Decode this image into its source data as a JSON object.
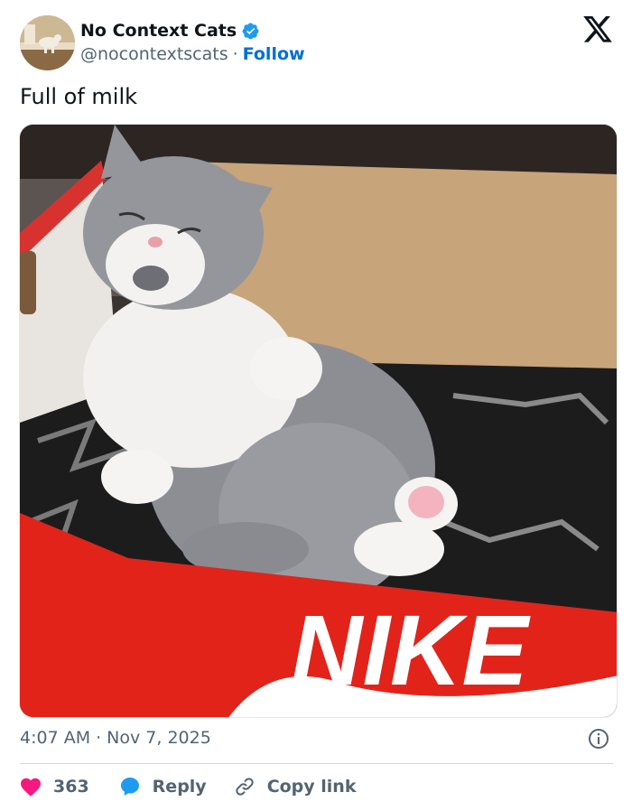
{
  "author": {
    "name": "No Context Cats",
    "handle": "@nocontextscats",
    "separator": "·",
    "follow_label": "Follow",
    "verified": true
  },
  "tweet": {
    "text": "Full of milk",
    "image_icon": "photo-cat-in-shoebox",
    "time": "4:07 AM",
    "separator": "·",
    "date": "Nov 7, 2025"
  },
  "actions": {
    "like_count": "363",
    "reply_label": "Reply",
    "copy_label": "Copy link"
  },
  "colors": {
    "like": "#f91880",
    "reply": "#1d9bf0",
    "verified": "#1d9bf0",
    "follow": "#006fd6",
    "text_secondary": "#536471"
  },
  "icons": {
    "verified": "verified-badge-icon",
    "logo": "x-logo-icon",
    "info": "info-icon",
    "like": "heart-icon",
    "reply": "speech-bubble-icon",
    "copy": "link-icon"
  }
}
